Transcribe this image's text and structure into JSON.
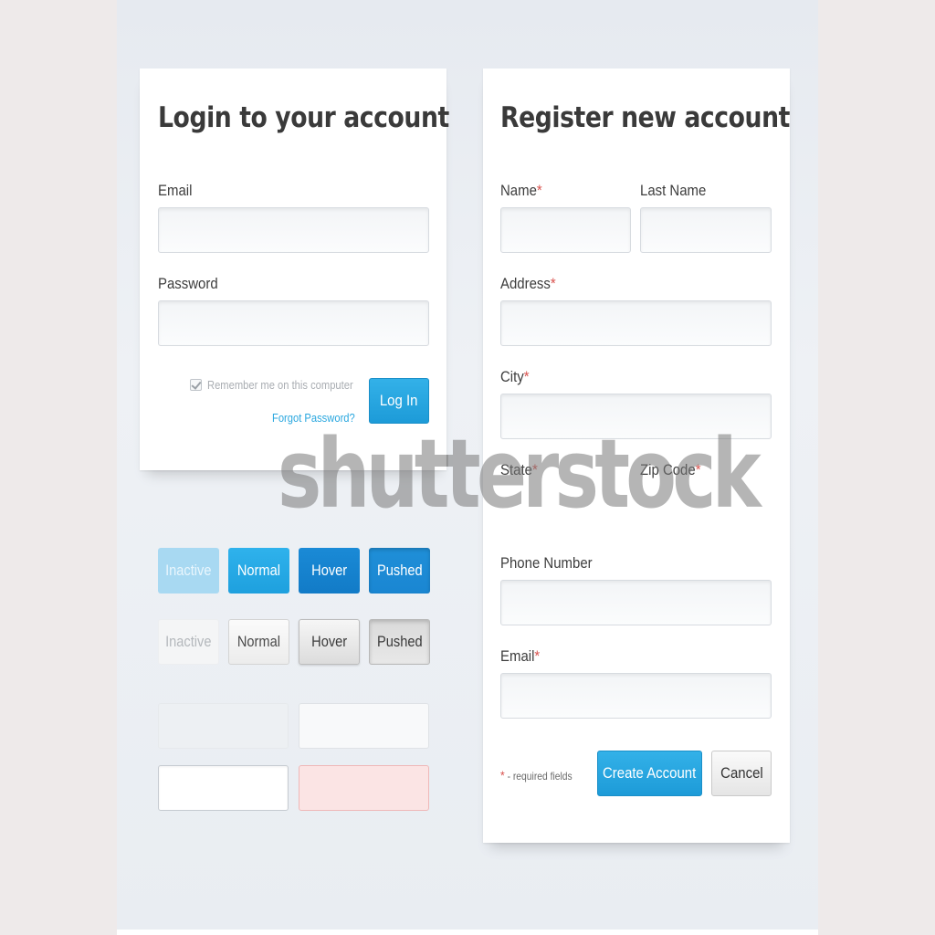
{
  "login": {
    "title": "Login to your account",
    "email_label": "Email",
    "password_label": "Password",
    "remember_label": "Remember me on this computer",
    "forgot_link": "Forgot Password?",
    "login_button": "Log In"
  },
  "register": {
    "title": "Register new account",
    "name_label": "Name",
    "last_name_label": "Last Name",
    "address_label": "Address",
    "city_label": "City",
    "state_label": "State",
    "zip_label": "Zip Code",
    "phone_label": "Phone Number",
    "email_label": "Email",
    "required_marker": "*",
    "required_note": "- required fields",
    "create_button": "Create Account",
    "cancel_button": "Cancel"
  },
  "button_states": {
    "blue": [
      "Inactive",
      "Normal",
      "Hover",
      "Pushed"
    ],
    "grey": [
      "Inactive",
      "Normal",
      "Hover",
      "Pushed"
    ]
  },
  "watermark": "shutterstock",
  "colors": {
    "accent_blue": "#1e9fdc",
    "required_red": "#d9534f",
    "error_fill": "#fbe4e4"
  }
}
